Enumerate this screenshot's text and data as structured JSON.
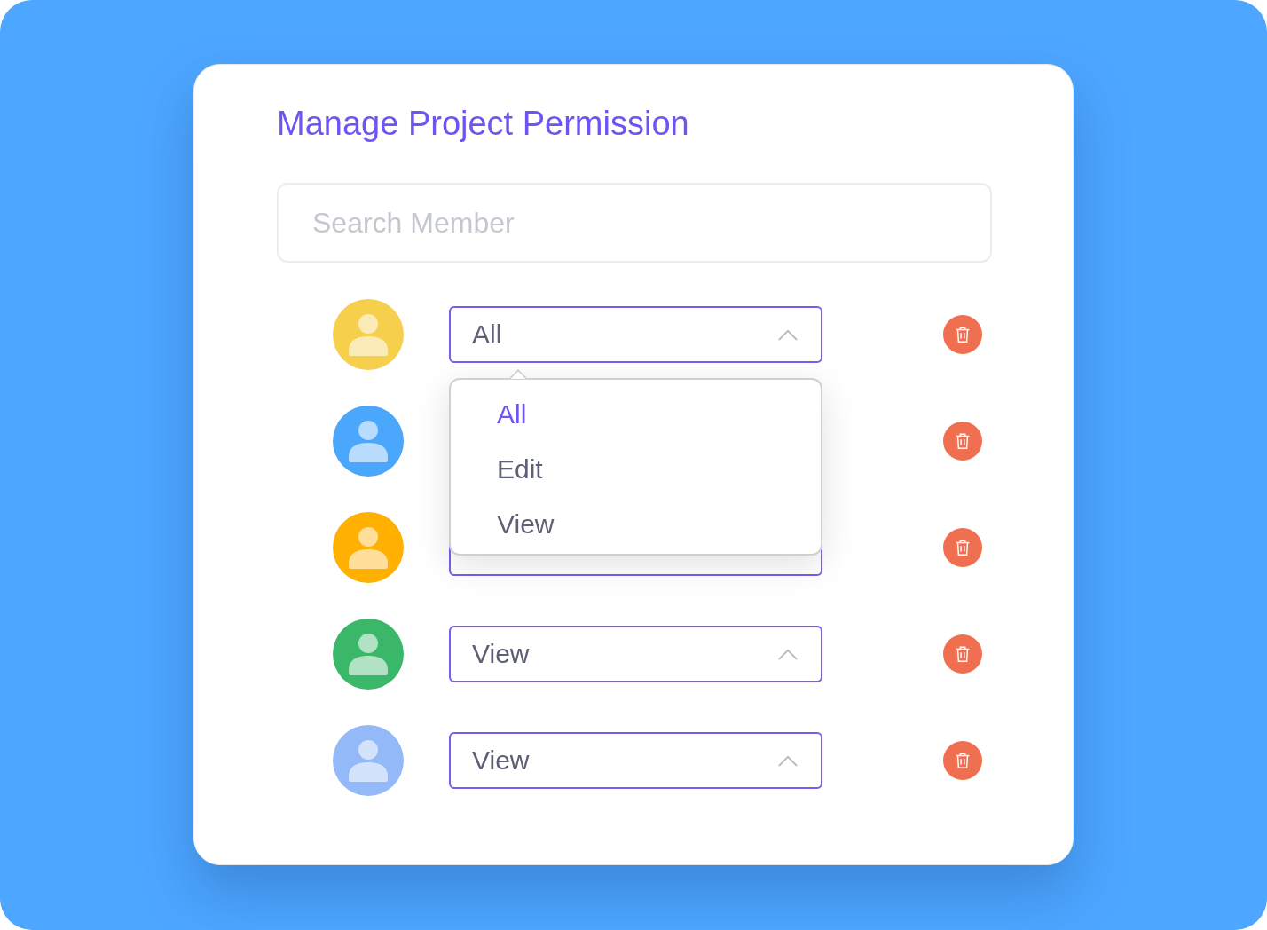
{
  "title": "Manage Project Permission",
  "search": {
    "placeholder": "Search Member"
  },
  "members": [
    {
      "color": "#f6d04d",
      "select": {
        "value": "All",
        "open": true
      }
    },
    {
      "color": "#4ba7fb"
    },
    {
      "color": "#ffb000",
      "select": {
        "open": false
      }
    },
    {
      "color": "#3bb76a",
      "select": {
        "value": "View",
        "open": false
      }
    },
    {
      "color": "#93b9f8",
      "select": {
        "value": "View",
        "open": false
      }
    }
  ],
  "menu": [
    {
      "label": "All",
      "selected": true
    },
    {
      "label": "Edit",
      "selected": false
    },
    {
      "label": "View",
      "selected": false
    }
  ]
}
